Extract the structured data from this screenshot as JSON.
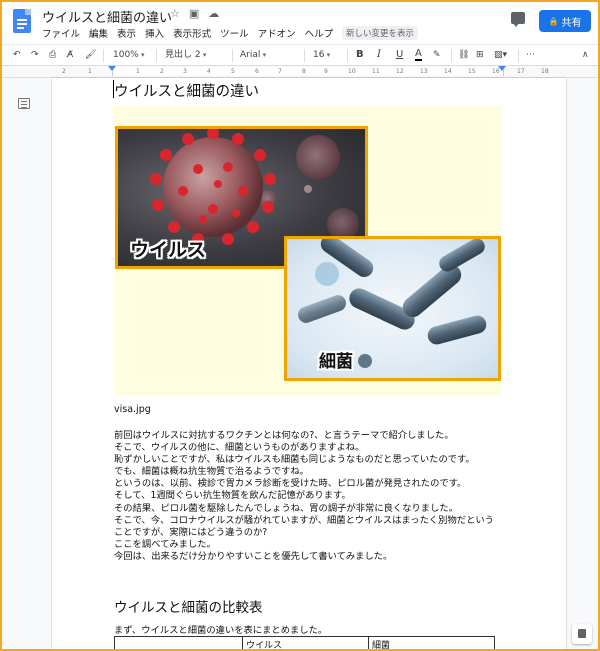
{
  "app": {
    "doc_title": "ウイルスと細菌の違い",
    "menu": [
      "ファイル",
      "編集",
      "表示",
      "挿入",
      "表示形式",
      "ツール",
      "アドオン",
      "ヘルプ"
    ],
    "changes_label": "新しい変更を表示",
    "share_label": "共有"
  },
  "toolbar": {
    "zoom": "100%",
    "style": "見出し 2",
    "font": "Arial",
    "font_size": "16",
    "bold": "B",
    "italic": "I",
    "underline": "U",
    "text_color": "A"
  },
  "ruler": {
    "numbers": [
      "2",
      "1",
      "1",
      "2",
      "3",
      "4",
      "5",
      "6",
      "7",
      "8",
      "9",
      "10",
      "11",
      "12",
      "13",
      "14",
      "15",
      "16",
      "17",
      "18"
    ]
  },
  "document": {
    "heading": "ウイルスと細菌の違い",
    "image_label_virus": "ウイルス",
    "image_label_bacteria": "細菌",
    "caption": "visa.jpg",
    "paragraphs": [
      "前回はウイルスに対抗するワクチンとは何なの?、と言うテーマで紹介しました。",
      "そこで、ウイルスの他に、細菌というものがありますよね。",
      "恥ずかしいことですが、私はウイルスも細菌も同じようなものだと思っていたのです。",
      "でも、細菌は概ね抗生物質で治るようですね。",
      "というのは、以前、検診で胃カメラ診断を受けた時、ピロル菌が発見されたのです。",
      "そして、1週間ぐらい抗生物質を飲んだ記憶があります。",
      "その結果、ピロル菌を駆除したんでしょうね、胃の調子が非常に良くなりました。",
      "そこで、今、コロナウイルスが騒がれていますが、細菌とウイルスはまったく別物だという",
      "ことですが、実際にはどう違うのか?",
      "ここを調べてみました。",
      "今回は、出来るだけ分かりやすいことを優先して書いてみました。"
    ],
    "section_heading": "ウイルスと細菌の比較表",
    "table_intro": "まず、ウイルスと細菌の違いを表にまとめました。",
    "table_header": [
      "",
      "ウイルス",
      "細菌"
    ]
  },
  "colors": {
    "accent": "#1a73e8",
    "frame": "#f5a623",
    "image_border": "#f0a400",
    "image_bg": "#fffde0"
  }
}
